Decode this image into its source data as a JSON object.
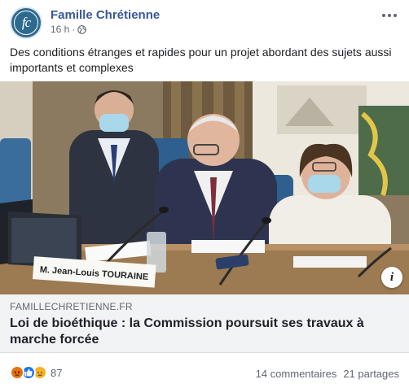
{
  "post": {
    "page_name": "Famille Chrétienne",
    "avatar_text": "fc",
    "time": "16 h",
    "separator": "·",
    "text": "Des conditions étranges et rapides pour un projet abordant des sujets aussi importants et complexes"
  },
  "photo": {
    "nameplate": "M. Jean-Louis TOURAINE",
    "info_label": "i"
  },
  "link": {
    "domain": "FAMILLECHRETIENNE.FR",
    "title": "Loi de bioéthique : la Commission poursuit ses travaux à marche forcée"
  },
  "footer": {
    "reaction_count": "87",
    "comments": "14 commentaires",
    "shares": "21 partages",
    "reaction_icons": [
      "angry-icon",
      "like-icon",
      "sad-icon"
    ]
  },
  "colors": {
    "page_name": "#385898",
    "link_bg": "#f2f3f5",
    "like": "#1877f2",
    "angry": "#e9710f",
    "sad": "#f7b125"
  }
}
